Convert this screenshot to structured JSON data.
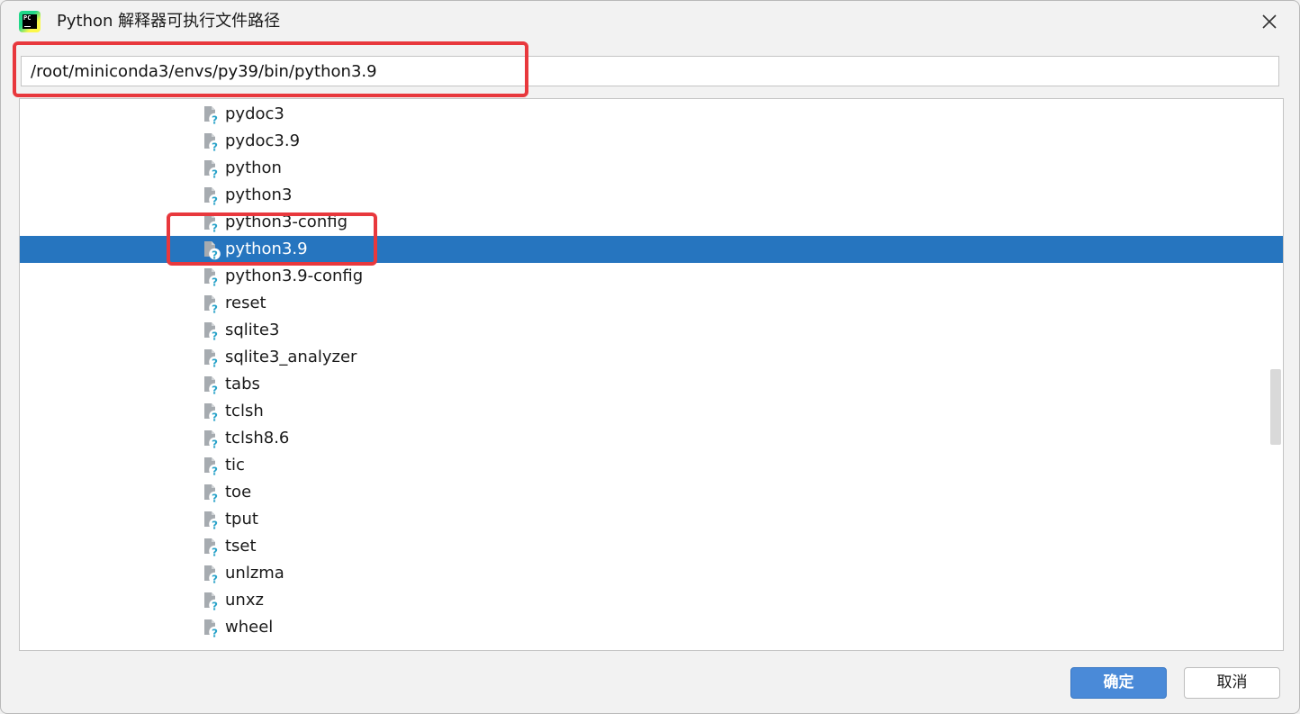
{
  "window": {
    "title": "Python 解释器可执行文件路径",
    "app_icon": "pycharm-logo-icon",
    "app_icon_text": "PC"
  },
  "path_field": {
    "value": "/root/miniconda3/envs/py39/bin/python3.9"
  },
  "file_tree": {
    "items": [
      {
        "label": "pydoc3",
        "icon": "unknown-file-icon",
        "selected": false
      },
      {
        "label": "pydoc3.9",
        "icon": "unknown-file-icon",
        "selected": false
      },
      {
        "label": "python",
        "icon": "unknown-file-icon",
        "selected": false
      },
      {
        "label": "python3",
        "icon": "unknown-file-icon",
        "selected": false
      },
      {
        "label": "python3-config",
        "icon": "unknown-file-icon",
        "selected": false
      },
      {
        "label": "python3.9",
        "icon": "unknown-file-icon",
        "selected": true
      },
      {
        "label": "python3.9-config",
        "icon": "unknown-file-icon",
        "selected": false
      },
      {
        "label": "reset",
        "icon": "unknown-file-icon",
        "selected": false
      },
      {
        "label": "sqlite3",
        "icon": "unknown-file-icon",
        "selected": false
      },
      {
        "label": "sqlite3_analyzer",
        "icon": "unknown-file-icon",
        "selected": false
      },
      {
        "label": "tabs",
        "icon": "unknown-file-icon",
        "selected": false
      },
      {
        "label": "tclsh",
        "icon": "unknown-file-icon",
        "selected": false
      },
      {
        "label": "tclsh8.6",
        "icon": "unknown-file-icon",
        "selected": false
      },
      {
        "label": "tic",
        "icon": "unknown-file-icon",
        "selected": false
      },
      {
        "label": "toe",
        "icon": "unknown-file-icon",
        "selected": false
      },
      {
        "label": "tput",
        "icon": "unknown-file-icon",
        "selected": false
      },
      {
        "label": "tset",
        "icon": "unknown-file-icon",
        "selected": false
      },
      {
        "label": "unlzma",
        "icon": "unknown-file-icon",
        "selected": false
      },
      {
        "label": "unxz",
        "icon": "unknown-file-icon",
        "selected": false
      },
      {
        "label": "wheel",
        "icon": "unknown-file-icon",
        "selected": false
      }
    ]
  },
  "buttons": {
    "ok_label": "确定",
    "cancel_label": "取消"
  },
  "colors": {
    "selection": "#2675bf",
    "annotation_red": "#e8383d",
    "ok_button": "#4a8ad8"
  }
}
